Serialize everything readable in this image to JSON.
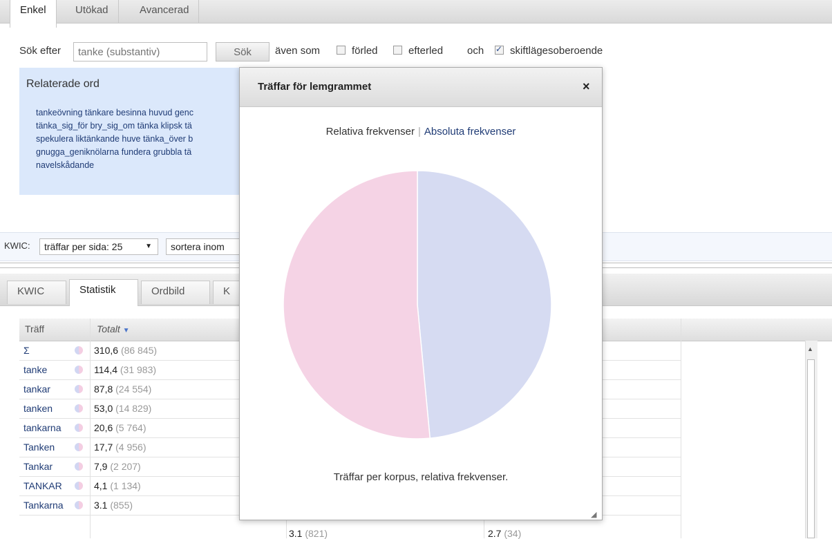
{
  "search_tabs": [
    "Enkel",
    "Utökad",
    "Avancerad"
  ],
  "search": {
    "label": "Sök efter",
    "placeholder": "tanke (substantiv)",
    "button": "Sök",
    "also_label": "även som",
    "prefix_label": "förled",
    "suffix_label": "efterled",
    "and_label": "och",
    "case_label": "skiftlägesoberoende",
    "prefix_checked": false,
    "suffix_checked": false,
    "case_checked": true
  },
  "related": {
    "title": "Relaterade ord",
    "lines": [
      "tankeövning tänkare besinna huvud genc",
      "tänka_sig_för bry_sig_om tänka klipsk tä",
      "spekulera liktänkande huve tänka_över b",
      "gnugga_geniknölarna fundera grubbla tä",
      "navelskådande"
    ]
  },
  "kwic": {
    "label": "KWIC:",
    "per_page": "träffar per sida: 25",
    "sort": "sortera inom"
  },
  "result_tabs": [
    "KWIC",
    "Statistik",
    "Ordbild",
    "K"
  ],
  "table": {
    "col_hit": "Träff",
    "col_total": "Totalt",
    "rows": [
      {
        "name": "Σ",
        "rel": "310,6",
        "abs": "(86 845)"
      },
      {
        "name": "tanke",
        "rel": "114,4",
        "abs": "(31 983)"
      },
      {
        "name": "tankar",
        "rel": "87,8",
        "abs": "(24 554)"
      },
      {
        "name": "tanken",
        "rel": "53,0",
        "abs": "(14 829)"
      },
      {
        "name": "tankarna",
        "rel": "20,6",
        "abs": "(5 764)"
      },
      {
        "name": "Tanken",
        "rel": "17,7",
        "abs": "(4 956)"
      },
      {
        "name": "Tankar",
        "rel": "7,9",
        "abs": "(2 207)"
      },
      {
        "name": "TANKAR",
        "rel": "4,1",
        "abs": "(1 134)"
      },
      {
        "name": "Tankarna",
        "rel": "3.1",
        "abs": "(855)"
      }
    ],
    "last_row_extra": [
      {
        "rel": "3.1",
        "abs": "(821)"
      },
      {
        "rel": "2.7",
        "abs": "(34)"
      }
    ]
  },
  "dialog": {
    "title": "Träffar för lemgrammet",
    "close": "×",
    "toggle_relative": "Relativa frekvenser",
    "toggle_sep": "|",
    "toggle_absolute": "Absoluta frekvenser",
    "caption": "Träffar per korpus, relativa frekvenser."
  },
  "chart_data": {
    "type": "pie",
    "slices": [
      {
        "value": 48.5,
        "color": "#d6dbf2"
      },
      {
        "value": 51.5,
        "color": "#f5d3e5"
      }
    ]
  },
  "colors": {
    "related_bg": "#dbe8fb",
    "link": "#1f3b75",
    "pie_blue": "#d6dbf2",
    "pie_pink": "#f5d3e5"
  }
}
